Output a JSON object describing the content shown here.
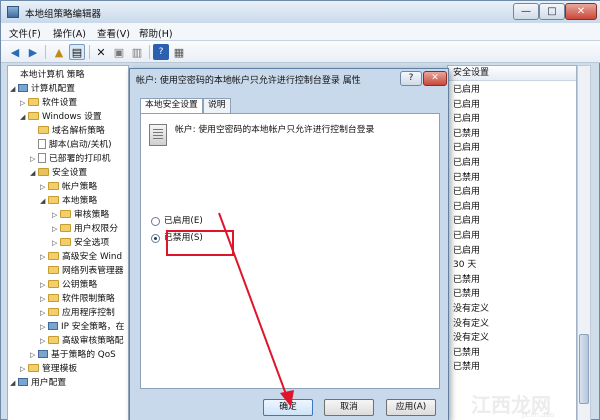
{
  "app": {
    "title": "本地组策略编辑器"
  },
  "window_controls": {
    "minimize": "—",
    "maximize": "□",
    "close": "✕"
  },
  "menu": [
    "文件(F)",
    "操作(A)",
    "查看(V)",
    "帮助(H)"
  ],
  "tree": [
    {
      "label": "本地计算机 策略",
      "expander": "",
      "icon": "pc-icon"
    },
    {
      "label": "计算机配置",
      "expander": "◢",
      "icon": "pc-icon"
    },
    {
      "label": "软件设置",
      "expander": "▷",
      "icon": "folder-icon"
    },
    {
      "label": "Windows 设置",
      "expander": "◢",
      "icon": "folder-icon"
    },
    {
      "label": "域名解析策略",
      "expander": "",
      "icon": "folder-icon"
    },
    {
      "label": "脚本(启动/关机)",
      "expander": "",
      "icon": "document-icon"
    },
    {
      "label": "已部署的打印机",
      "expander": "▷",
      "icon": "folder-icon"
    },
    {
      "label": "安全设置",
      "expander": "◢",
      "icon": "folder-icon"
    },
    {
      "label": "帐户策略",
      "expander": "▷",
      "icon": "folder-icon"
    },
    {
      "label": "本地策略",
      "expander": "◢",
      "icon": "folder-icon"
    },
    {
      "label": "审核策略",
      "expander": "▷",
      "icon": "folder-icon"
    },
    {
      "label": "用户权限分",
      "expander": "▷",
      "icon": "folder-icon"
    },
    {
      "label": "安全选项",
      "expander": "▷",
      "icon": "folder-icon"
    },
    {
      "label": "高级安全 Wind",
      "expander": "▷",
      "icon": "folder-icon"
    },
    {
      "label": "网络列表管理器",
      "expander": "",
      "icon": "folder-icon"
    },
    {
      "label": "公钥策略",
      "expander": "▷",
      "icon": "folder-icon"
    },
    {
      "label": "软件限制策略",
      "expander": "▷",
      "icon": "folder-icon"
    },
    {
      "label": "应用程序控制",
      "expander": "▷",
      "icon": "folder-icon"
    },
    {
      "label": "IP 安全策略，在",
      "expander": "▷",
      "icon": "folder-icon"
    },
    {
      "label": "高级审核策略配",
      "expander": "▷",
      "icon": "folder-icon"
    },
    {
      "label": "基于策略的 QoS",
      "expander": "▷",
      "icon": "folder-icon"
    },
    {
      "label": "管理模板",
      "expander": "▷",
      "icon": "folder-icon"
    },
    {
      "label": "用户配置",
      "expander": "◢",
      "icon": "pc-icon"
    }
  ],
  "list": {
    "header": "安全设置",
    "rows": [
      "已启用",
      "已启用",
      "已启用",
      "已禁用",
      "已启用",
      "已启用",
      "已禁用",
      "已启用",
      "已启用",
      "已启用",
      "已启用",
      "已启用",
      "30 天",
      "已禁用",
      "已禁用",
      "没有定义",
      "没有定义",
      "没有定义",
      "已禁用",
      "已禁用"
    ]
  },
  "dialog": {
    "title": "帐户: 使用空密码的本地帐户只允许进行控制台登录 属性",
    "help": "?",
    "close": "✕",
    "tabs": [
      "本地安全设置",
      "说明"
    ],
    "policy_description": "帐户: 使用空密码的本地帐户只允许进行控制台登录",
    "options": [
      {
        "label": "已启用(E)",
        "checked": false
      },
      {
        "label": "已禁用(S)",
        "checked": true
      }
    ],
    "buttons": {
      "ok": "确定",
      "cancel": "取消",
      "apply": "应用(A)"
    }
  },
  "annotation": {
    "color": "#e0142a"
  },
  "watermark": {
    "text": "江西龙网",
    "sub": "jx.nh.aao"
  }
}
